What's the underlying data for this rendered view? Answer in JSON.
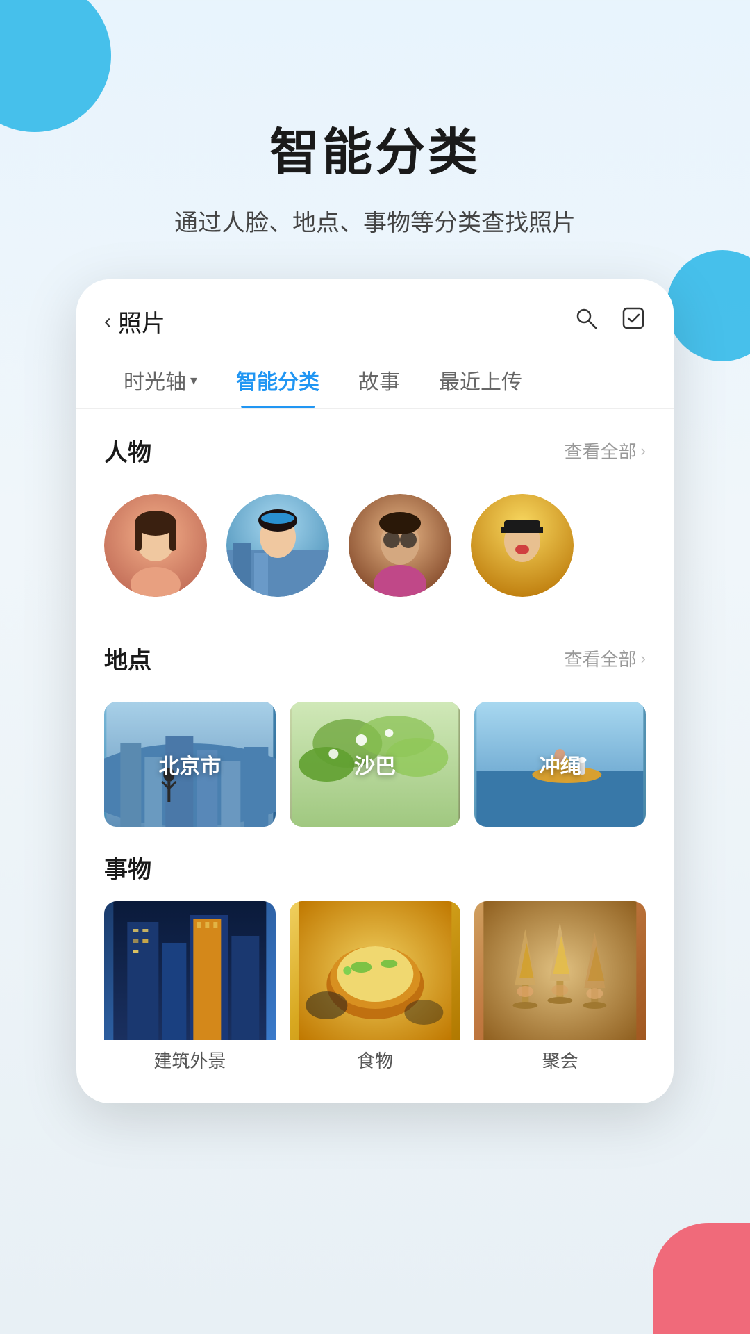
{
  "page": {
    "background": {
      "topCircleColor": "#29b6e8",
      "rightCircleColor": "#29b6e8",
      "coralColor": "#f06a7a"
    },
    "header": {
      "mainTitle": "智能分类",
      "subTitle": "通过人脸、地点、事物等分类查找照片"
    },
    "appBar": {
      "backLabel": "照片",
      "searchIconLabel": "search-icon",
      "checkIconLabel": "check-square-icon"
    },
    "tabs": [
      {
        "label": "时光轴",
        "hasDropdown": true,
        "active": false
      },
      {
        "label": "智能分类",
        "hasDropdown": false,
        "active": true
      },
      {
        "label": "故事",
        "hasDropdown": false,
        "active": false
      },
      {
        "label": "最近上传",
        "hasDropdown": false,
        "active": false
      }
    ],
    "sections": {
      "people": {
        "title": "人物",
        "viewAllLabel": "查看全部",
        "avatars": [
          {
            "id": 1,
            "bgClass": "avatar-1",
            "initials": ""
          },
          {
            "id": 2,
            "bgClass": "avatar-2",
            "initials": ""
          },
          {
            "id": 3,
            "bgClass": "avatar-3",
            "initials": ""
          },
          {
            "id": 4,
            "bgClass": "avatar-4",
            "initials": ""
          }
        ]
      },
      "places": {
        "title": "地点",
        "viewAllLabel": "查看全部",
        "items": [
          {
            "id": 1,
            "label": "北京市",
            "bgClass": "place-bg-1"
          },
          {
            "id": 2,
            "label": "沙巴",
            "bgClass": "place-bg-2"
          },
          {
            "id": 3,
            "label": "冲绳",
            "bgClass": "place-bg-3"
          }
        ]
      },
      "things": {
        "title": "事物",
        "items": [
          {
            "id": 1,
            "label": "建筑外景",
            "bgClass": "thing-bg-1"
          },
          {
            "id": 2,
            "label": "食物",
            "bgClass": "thing-bg-2"
          },
          {
            "id": 3,
            "label": "聚会",
            "bgClass": "thing-bg-3"
          }
        ]
      }
    }
  }
}
